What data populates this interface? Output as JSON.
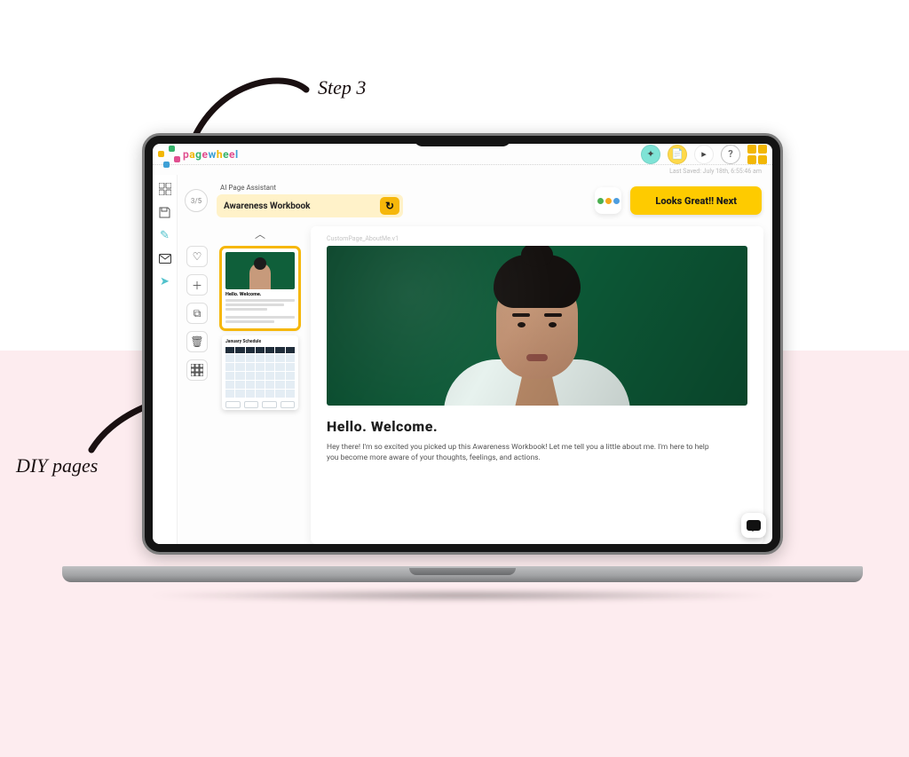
{
  "annotations": {
    "step3": "Step 3",
    "diy": "DIY pages"
  },
  "brand": "pagewheel",
  "titlebar": {
    "help_label": "?"
  },
  "last_saved": "Last Saved: July 18th, 6:55:46 am",
  "toolbar": {
    "step": "3/5",
    "assistant_label": "AI Page Assistant",
    "assistant_value": "Awareness Workbook",
    "next_label": "Looks Great!! Next"
  },
  "thumbs": {
    "thumb1_title": "Hello. Welcome.",
    "thumb2_title": "January Schedule"
  },
  "preview": {
    "tag": "CustomPage_AboutMe.v1",
    "headline": "Hello. Welcome.",
    "body": "Hey there! I'm so excited you picked up this Awareness Workbook! Let me tell you a little about me. I'm here to help you become more aware of your thoughts, feelings, and actions."
  }
}
